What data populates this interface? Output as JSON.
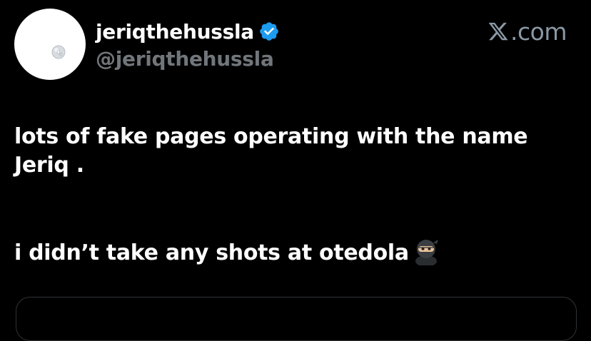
{
  "author": {
    "display_name": "jeriqthehussla",
    "handle": "@jeriqthehussla",
    "verified": true,
    "verified_icon": "verified-badge-icon",
    "avatar_icon": "cd-disc-icon"
  },
  "source": {
    "site_label": ".com",
    "logo_icon": "x-logo-icon"
  },
  "tweet": {
    "line1": "lots of fake pages operating with the name",
    "line2": "Jeriq .",
    "line3": "i didn’t take any shots at otedola",
    "emoji": "ninja-emoji-icon"
  },
  "colors": {
    "background": "#000000",
    "text_primary": "#ffffff",
    "text_secondary": "#71767b",
    "verified_blue": "#1d9bf0",
    "card_border": "#2f3336"
  }
}
